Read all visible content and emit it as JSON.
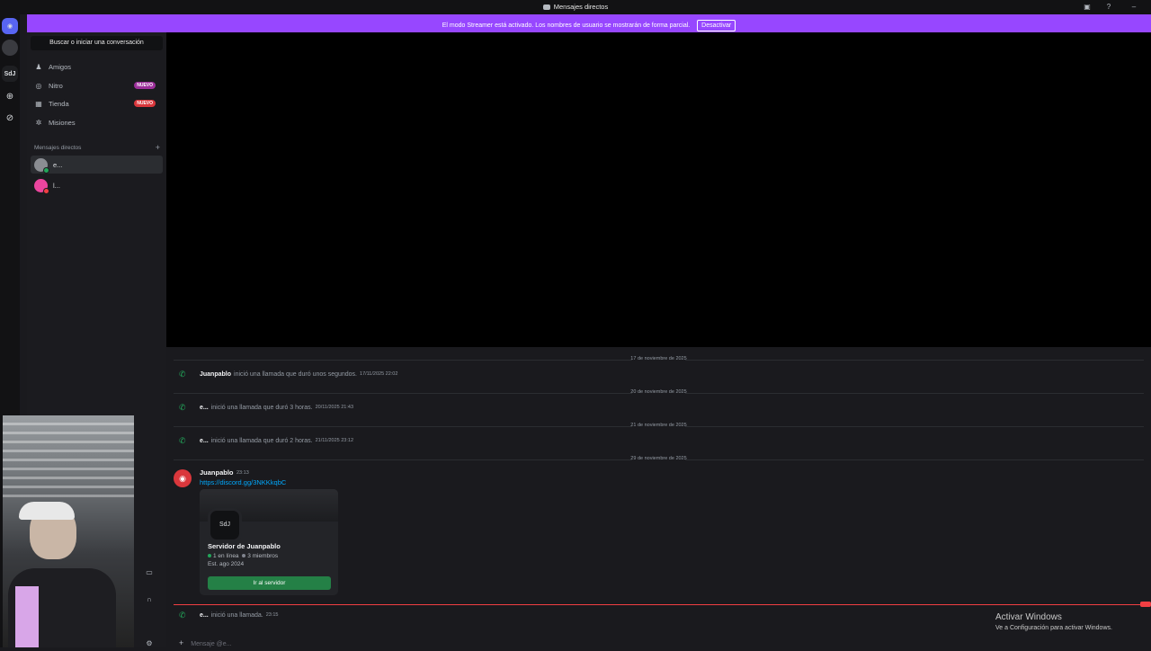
{
  "window": {
    "title": "Mensajes directos"
  },
  "banner": {
    "text": "El modo Streamer está activado. Los nombres de usuario se mostrarán de forma parcial.",
    "button": "Desactivar"
  },
  "rail": {
    "server_label": "SdJ"
  },
  "sidebar": {
    "search_label": "Buscar o iniciar una conversación",
    "nav": [
      {
        "label": "Amigos",
        "icon": "friends-icon"
      },
      {
        "label": "Nitro",
        "icon": "nitro-icon",
        "badge": "NUEVO"
      },
      {
        "label": "Tienda",
        "icon": "shop-icon",
        "badge": "NUEVO"
      },
      {
        "label": "Misiones",
        "icon": "quests-icon"
      }
    ],
    "dm_header": "Mensajes directos",
    "dms": [
      {
        "name": "e..."
      },
      {
        "name": "l..."
      }
    ]
  },
  "chat": {
    "entries": [
      {
        "date": "17 de noviembre de 2025",
        "who": "Juanpablo",
        "text": "inició una llamada que duró unos segundos.",
        "ts": "17/11/2025 22:02"
      },
      {
        "date": "20 de noviembre de 2025",
        "who": "e...",
        "text": "inició una llamada que duró 3 horas.",
        "ts": "20/11/2025 21:43"
      },
      {
        "date": "21 de noviembre de 2025",
        "who": "e...",
        "text": "inició una llamada que duró 2 horas.",
        "ts": "21/11/2025 23:12"
      },
      {
        "date": "29 de noviembre de 2025"
      }
    ],
    "message": {
      "author": "Juanpablo",
      "time": "23:13",
      "link": "https://discord.gg/3NKKkqbC",
      "invite": {
        "icon_text": "SdJ",
        "server_name": "Servidor de Juanpablo",
        "online": "1 en línea",
        "members": "3 miembros",
        "established": "Est. ago 2024",
        "button": "Ir al servidor"
      }
    },
    "last_call": {
      "who": "e...",
      "text": "inició una llamada.",
      "ts": "23:15"
    },
    "composer_placeholder": "Mensaje @e..."
  },
  "windows_watermark": {
    "line1": "Activar Windows",
    "line2": "Ve a Configuración para activar Windows."
  },
  "colors": {
    "accent": "#5865f2",
    "banner": "#9747ff",
    "green": "#23a55a",
    "link": "#00a8fc",
    "new_line": "#f23f43"
  }
}
